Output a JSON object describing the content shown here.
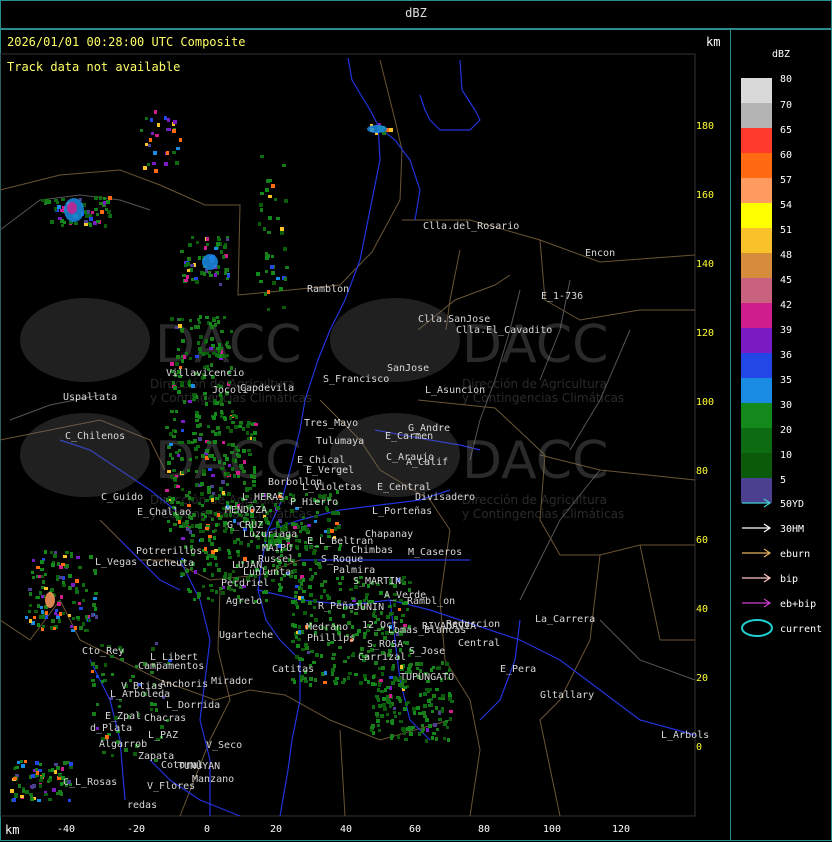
{
  "window": {
    "title": "dBZ"
  },
  "map": {
    "timestamp": "2026/01/01 00:28:00 UTC Composite",
    "track_status": "Track data not available",
    "unit_label_top": "km",
    "unit_label_bottom": "km",
    "y_ticks": [
      "180",
      "160",
      "140",
      "120",
      "100",
      "80",
      "60",
      "40",
      "20",
      "0"
    ],
    "x_ticks": [
      "-40",
      "-20",
      "0",
      "20",
      "40",
      "60",
      "80",
      "100",
      "120"
    ],
    "watermark": {
      "brand": "DACC",
      "line1": "Dirección de Agricultura",
      "line2": "y Contingencias Climáticas"
    },
    "places": [
      "Clla.del_Rosario",
      "Encon",
      "E_1-736",
      "Ramblon",
      "Clla.SanJose",
      "Clla.El_Cavadito",
      "S_Francisco",
      "SanJose",
      "L_Asuncion",
      "Villavicencio",
      "Jocoli",
      "Capdevila",
      "Uspallata",
      "C_Chilenos",
      "Tres_Mayo",
      "Tulumaya",
      "G_Andre",
      "E_Carmen",
      "E_Chical",
      "C_Araujo",
      "E_Vergel",
      "A_Calif",
      "Borbollon",
      "L_Violetas",
      "E_Central",
      "P_Hierro",
      "Divisadero",
      "C_Guido",
      "E_Challao",
      "L_HERAS",
      "MENDOZA",
      "L_Porteñas",
      "G_CRUZ",
      "Luzuriaga",
      "E_L_Beltran",
      "Chapanay",
      "MAIPU",
      "Chimbas",
      "M_Caseros",
      "Potrerillos",
      "Cacheuta",
      "Russel",
      "S_Roque",
      "L_Vegas",
      "LUJAN",
      "Palmira",
      "Lunlunta",
      "S_MARTIN",
      "Perdriel",
      "A_Verde",
      "Rambl_on",
      "Agrelo",
      "R_Peña",
      "JUNIN",
      "Ugarteche",
      "Medrano",
      "RIVADAVIA",
      "12_Oct",
      "Reduccion",
      "Phillips",
      "Lomas_Blancas",
      "La_Carrera",
      "Cto_Rey",
      "L_Libert",
      "S_ROSA",
      "Central",
      "S_Jose",
      "Campamentos",
      "Carrizal",
      "Catitas",
      "E_Pera",
      "V_Btias",
      "Anchoris",
      "Mirador",
      "TUPUNGATO",
      "L_Arboleda",
      "L_Dorrida",
      "Gltallary",
      "E_Zpal",
      "Chacras",
      "d_Plata",
      "L_PAZ",
      "L_Arbols",
      "Algarrob",
      "Zapata",
      "V_Seco",
      "Cotoral",
      "TUNUYAN",
      "Manzano",
      "C_L_Rosas",
      "V_Flores",
      "redas"
    ]
  },
  "legend": {
    "title": "dBZ",
    "levels": [
      {
        "label": "80",
        "color": "#d9d9d9"
      },
      {
        "label": "70",
        "color": "#b4b4b4"
      },
      {
        "label": "65",
        "color": "#ff3a2c"
      },
      {
        "label": "60",
        "color": "#ff6a12"
      },
      {
        "label": "57",
        "color": "#ff9b5e"
      },
      {
        "label": "54",
        "color": "#ffff00"
      },
      {
        "label": "51",
        "color": "#f9c12a"
      },
      {
        "label": "48",
        "color": "#d68d3b"
      },
      {
        "label": "45",
        "color": "#c9627e"
      },
      {
        "label": "42",
        "color": "#cf1d8d"
      },
      {
        "label": "39",
        "color": "#7b1bc4"
      },
      {
        "label": "36",
        "color": "#2347e6"
      },
      {
        "label": "35",
        "color": "#1a8be3"
      },
      {
        "label": "30",
        "color": "#12891a"
      },
      {
        "label": "20",
        "color": "#0d6b12"
      },
      {
        "label": "10",
        "color": "#0a5a0a"
      },
      {
        "label": "5",
        "color": "#4b3f8f"
      }
    ],
    "tracks": [
      {
        "label": "50YD",
        "color": "#3fd0d0"
      },
      {
        "label": "30HM",
        "color": "#ffffff"
      },
      {
        "label": "eburn",
        "color": "#e6b060"
      },
      {
        "label": "bip",
        "color": "#ffc8c8"
      },
      {
        "label": "eb+bip",
        "color": "#d040d0"
      }
    ],
    "current_label": "current",
    "current_color": "#20d0d0"
  }
}
